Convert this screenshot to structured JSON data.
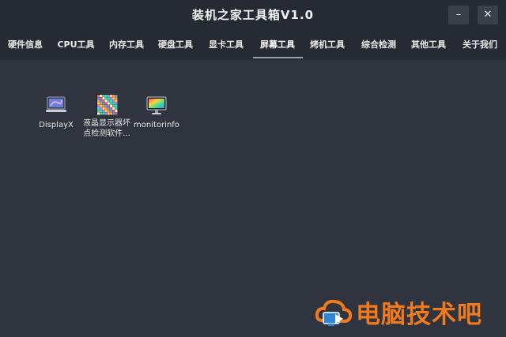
{
  "window": {
    "title": "装机之家工具箱V1.0",
    "minimize_glyph": "–",
    "close_glyph": "✕"
  },
  "tabs": [
    {
      "label": "硬件信息",
      "active": false
    },
    {
      "label": "CPU工具",
      "active": false
    },
    {
      "label": "内存工具",
      "active": false
    },
    {
      "label": "硬盘工具",
      "active": false
    },
    {
      "label": "显卡工具",
      "active": false
    },
    {
      "label": "屏幕工具",
      "active": true
    },
    {
      "label": "烤机工具",
      "active": false
    },
    {
      "label": "综合检测",
      "active": false
    },
    {
      "label": "其他工具",
      "active": false
    },
    {
      "label": "关于我们",
      "active": false
    }
  ],
  "apps": [
    {
      "label": "DisplayX",
      "icon": "laptop-icon"
    },
    {
      "label": "液晶显示器坏点检测软件...",
      "icon": "pixel-grid-icon"
    },
    {
      "label": "monitorinfo",
      "icon": "monitor-icon"
    }
  ],
  "watermark": {
    "text": "电脑技术吧",
    "color": "#f07a1c",
    "icon": "cloud-watermark-icon"
  }
}
